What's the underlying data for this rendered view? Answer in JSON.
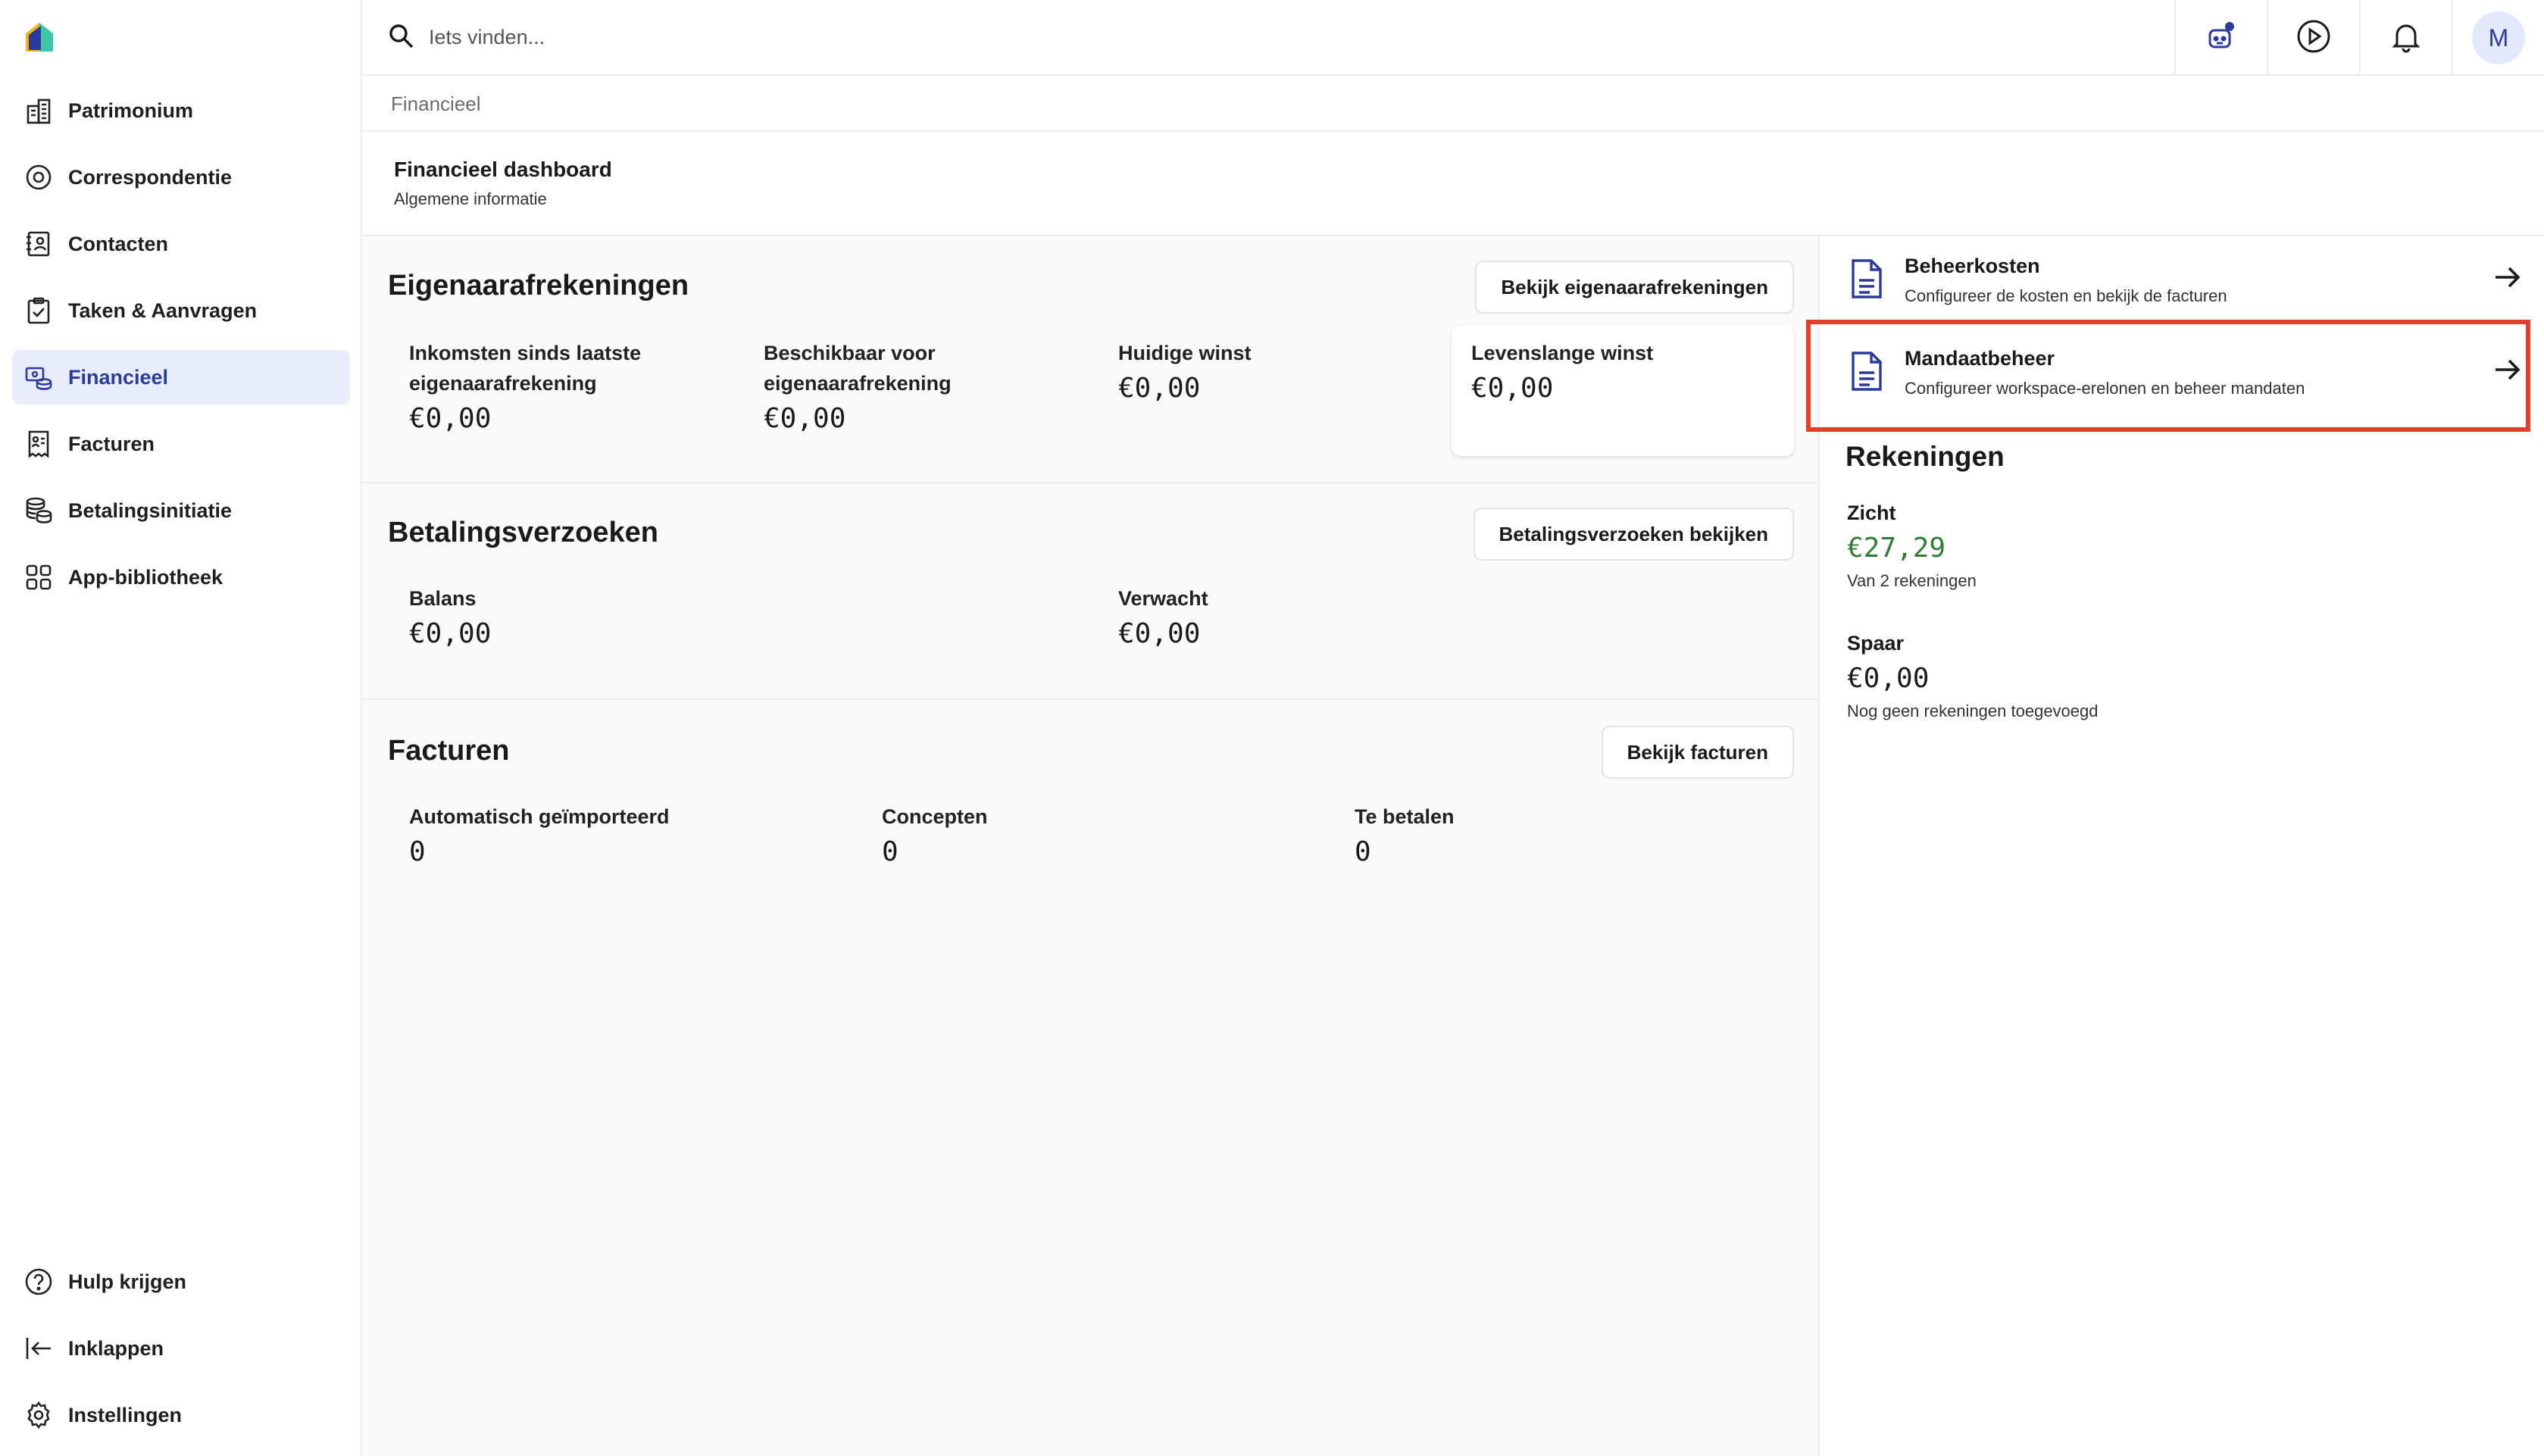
{
  "search": {
    "placeholder": "Iets vinden..."
  },
  "topbar": {
    "avatar_initial": "M"
  },
  "sidebar": {
    "items": [
      {
        "label": "Patrimonium",
        "icon": "building-icon"
      },
      {
        "label": "Correspondentie",
        "icon": "correspondence-icon"
      },
      {
        "label": "Contacten",
        "icon": "contacts-icon"
      },
      {
        "label": "Taken & Aanvragen",
        "icon": "clipboard-icon"
      },
      {
        "label": "Financieel",
        "icon": "finance-icon",
        "active": true
      },
      {
        "label": "Facturen",
        "icon": "invoice-icon"
      },
      {
        "label": "Betalingsinitiatie",
        "icon": "coins-icon"
      },
      {
        "label": "App-bibliotheek",
        "icon": "apps-grid-icon"
      }
    ],
    "bottom": [
      {
        "label": "Hulp krijgen",
        "icon": "help-icon"
      },
      {
        "label": "Inklappen",
        "icon": "collapse-icon"
      },
      {
        "label": "Instellingen",
        "icon": "gear-icon"
      }
    ]
  },
  "breadcrumb": "Financieel",
  "header": {
    "title": "Financieel dashboard",
    "subtitle": "Algemene informatie"
  },
  "owner": {
    "title": "Eigenaarafrekeningen",
    "button": "Bekijk eigenaarafrekeningen",
    "stats": [
      {
        "label_line1": "Inkomsten sinds laatste",
        "label_line2": "eigenaarafrekening",
        "value": "€0,00"
      },
      {
        "label_line1": "Beschikbaar voor",
        "label_line2": "eigenaarafrekening",
        "value": "€0,00"
      },
      {
        "label_line1": "Huidige winst",
        "value": "€0,00"
      },
      {
        "label_line1": "Levenslange winst",
        "value": "€0,00"
      }
    ]
  },
  "payments": {
    "title": "Betalingsverzoeken",
    "button": "Betalingsverzoeken bekijken",
    "stats": [
      {
        "label": "Balans",
        "value": "€0,00"
      },
      {
        "label": "Verwacht",
        "value": "€0,00"
      }
    ]
  },
  "invoices": {
    "title": "Facturen",
    "button": "Bekijk facturen",
    "stats": [
      {
        "label": "Automatisch geïmporteerd",
        "value": "0"
      },
      {
        "label": "Concepten",
        "value": "0"
      },
      {
        "label": "Te betalen",
        "value": "0"
      }
    ]
  },
  "right": {
    "links": [
      {
        "title": "Beheerkosten",
        "subtitle": "Configureer de kosten en bekijk de facturen"
      },
      {
        "title": "Mandaatbeheer",
        "subtitle": "Configureer workspace-erelonen en beheer mandaten"
      }
    ],
    "accounts_title": "Rekeningen",
    "accounts": [
      {
        "label": "Zicht",
        "value": "€27,29",
        "note": "Van 2 rekeningen",
        "color": "#2e7d32"
      },
      {
        "label": "Spaar",
        "value": "€0,00",
        "note": "Nog geen rekeningen toegevoegd",
        "color": "#1a1a1a"
      }
    ]
  },
  "colors": {
    "accent": "#2b3a9e",
    "active_bg": "#e8ecfb",
    "highlight": "#e2402c",
    "positive": "#2e7d32"
  }
}
